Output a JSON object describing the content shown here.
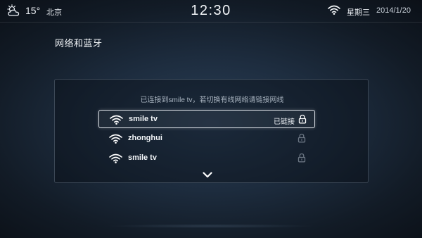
{
  "status_bar": {
    "weather_icon": "cloud-sun-icon",
    "temperature": "15°",
    "city": "北京",
    "time": "12:30",
    "wifi_icon": "wifi-icon",
    "weekday": "星期三",
    "date": "2014/1/20"
  },
  "page": {
    "title": "网络和蓝牙"
  },
  "wifi_panel": {
    "hint": "已连接到smile tv，若切换有线网络请链接网线",
    "networks": [
      {
        "ssid": "smile tv",
        "status": "已链接",
        "locked": true,
        "selected": true
      },
      {
        "ssid": "zhonghui",
        "status": "",
        "locked": true,
        "selected": false
      },
      {
        "ssid": "smile tv",
        "status": "",
        "locked": true,
        "selected": false
      }
    ],
    "more_icon": "chevron-down-icon"
  },
  "colors": {
    "accent": "#ffffff",
    "dim_lock": "#6b7683",
    "background": "#1d2c3e"
  }
}
